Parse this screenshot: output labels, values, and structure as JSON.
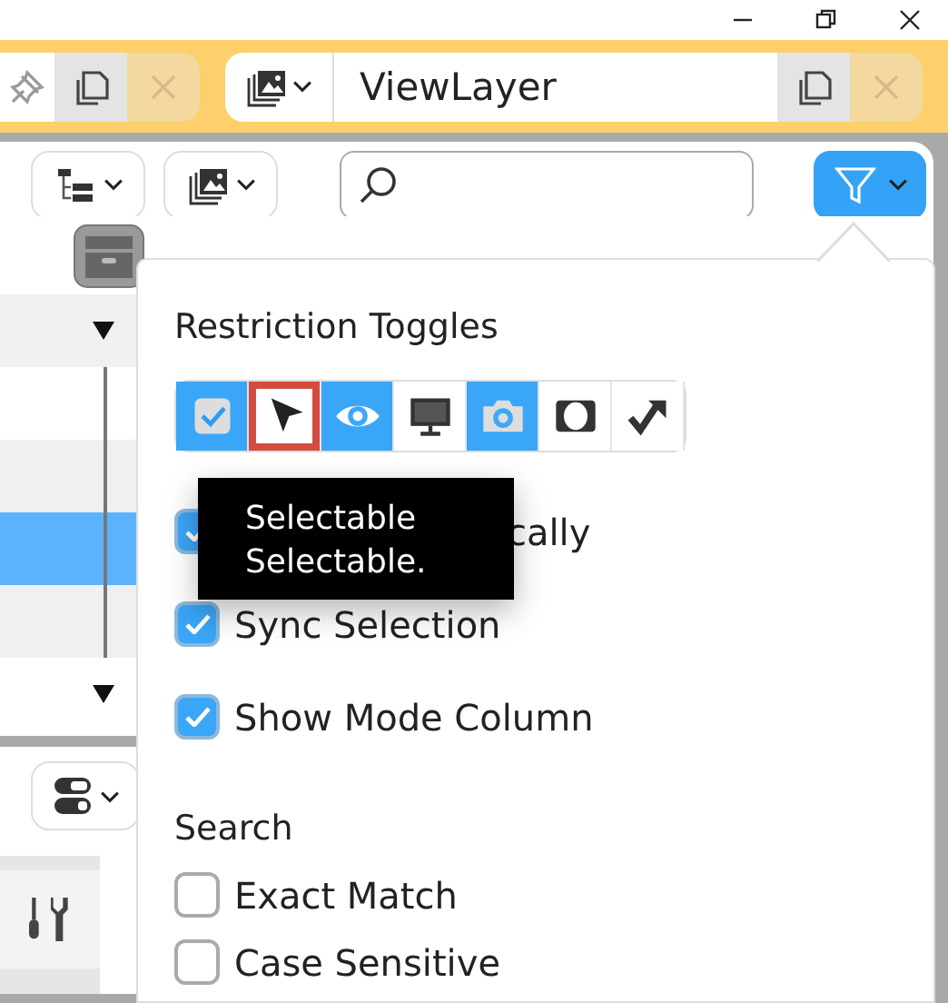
{
  "view_layer": {
    "name": "ViewLayer"
  },
  "outliner": {
    "filter_button": {
      "expanded": true
    },
    "rows": [
      {
        "kind": "header",
        "selected": false
      },
      {
        "kind": "collapsible",
        "selected": false
      },
      {
        "kind": "child",
        "selected": false
      },
      {
        "kind": "child",
        "selected": false
      },
      {
        "kind": "child",
        "selected": true
      },
      {
        "kind": "child",
        "selected": false
      },
      {
        "kind": "collapsible",
        "selected": false
      }
    ]
  },
  "filter_popup": {
    "title": "Restriction Toggles",
    "toggles": [
      {
        "kind": "checkbox",
        "on": true,
        "hovered": false
      },
      {
        "kind": "cursor",
        "on": false,
        "hovered": true
      },
      {
        "kind": "eye",
        "on": true,
        "hovered": false
      },
      {
        "kind": "monitor",
        "on": false,
        "hovered": false
      },
      {
        "kind": "camera",
        "on": true,
        "hovered": false
      },
      {
        "kind": "holdout",
        "on": false,
        "hovered": false
      },
      {
        "kind": "indirect",
        "on": false,
        "hovered": false
      }
    ],
    "tooltip": {
      "lines": [
        "Selectable",
        "Selectable."
      ]
    },
    "options": [
      {
        "label": "cally",
        "checked": true,
        "partial": true
      },
      {
        "label": "Sync Selection",
        "checked": true,
        "partial": false
      },
      {
        "label": "Show Mode Column",
        "checked": true,
        "partial": false
      }
    ],
    "search_heading": "Search",
    "search_options": [
      {
        "label": "Exact Match",
        "checked": false
      },
      {
        "label": "Case Sensitive",
        "checked": false
      }
    ]
  }
}
